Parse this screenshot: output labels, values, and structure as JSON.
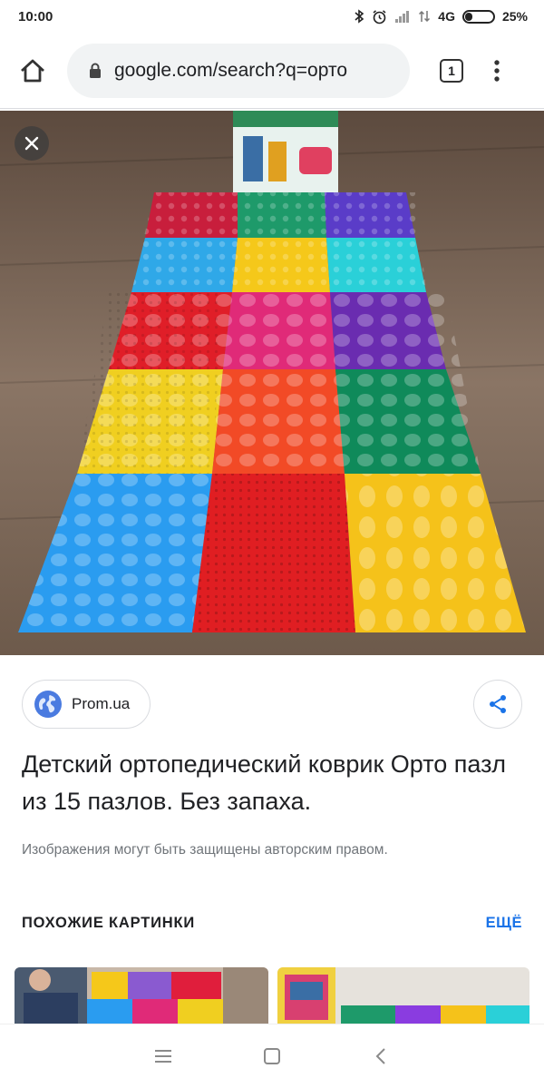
{
  "status_bar": {
    "time": "10:00",
    "network": "4G",
    "battery": "25%"
  },
  "browser": {
    "url": "google.com/search?q=орто",
    "tab_count": "1"
  },
  "image": {
    "alt_icon": "product-photo"
  },
  "source": {
    "name": "Prom.ua"
  },
  "result": {
    "title": "Детский ортопедический коврик Орто пазл из 15 пазлов. Без запаха.",
    "copyright": "Изображения могут быть защищены авторским правом."
  },
  "related": {
    "title": "ПОХОЖИЕ КАРТИНКИ",
    "more": "ЕЩЁ"
  },
  "colors": {
    "accent": "#1a73e8",
    "text": "#202124",
    "muted": "#70757a"
  }
}
